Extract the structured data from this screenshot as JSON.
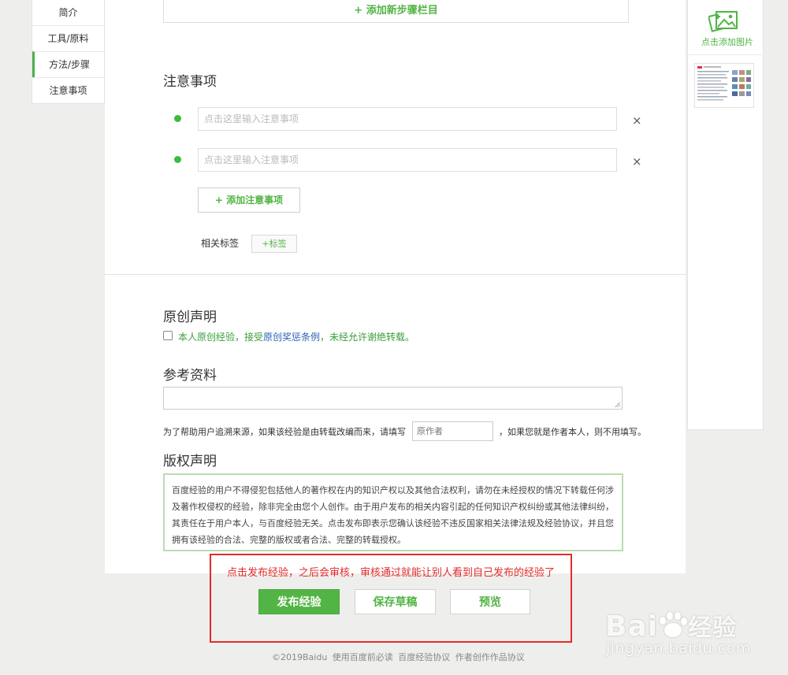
{
  "nav": {
    "items": [
      {
        "label": "简介"
      },
      {
        "label": "工具/原料"
      },
      {
        "label": "方法/步骤"
      },
      {
        "label": "注意事项"
      }
    ]
  },
  "steps": {
    "add_step_label": "+ 添加新步骤栏目"
  },
  "notes": {
    "title": "注意事项",
    "placeholder": "点击这里输入注意事项",
    "add_label": "+ 添加注意事项",
    "close_glyph": "×"
  },
  "tags": {
    "label": "相关标签",
    "button": "+标签"
  },
  "original": {
    "title": "原创声明",
    "text_before": "本人原创经验，接受",
    "link": "原创奖惩条例",
    "text_after": "，未经允许谢绝转载。"
  },
  "reference": {
    "title": "参考资料",
    "hint_before": "为了帮助用户追溯来源，如果该经验是由转载改编而来，请填写",
    "author_placeholder": "原作者",
    "hint_after": "，如果您就是作者本人，则不用填写。"
  },
  "copyright": {
    "title": "版权声明",
    "text": "百度经验的用户不得侵犯包括他人的著作权在内的知识产权以及其他合法权利，请勿在未经授权的情况下转载任何涉及著作权侵权的经验，除非完全由您个人创作。由于用户发布的相关内容引起的任何知识产权纠纷或其他法律纠纷，其责任在于用户本人，与百度经验无关。点击发布即表示您确认该经验不违反国家相关法律法规及经验协议，并且您拥有该经验的合法、完整的版权或者合法、完整的转载授权。"
  },
  "annotation": {
    "text": "点击发布经验，之后会审核，审核通过就能让别人看到自己发布的经验了"
  },
  "actions": {
    "publish": "发布经验",
    "draft": "保存草稿",
    "preview": "预览"
  },
  "footer": {
    "copyright": "©2019Baidu",
    "links": [
      "使用百度前必读",
      "百度经验协议",
      "作者创作作品协议"
    ]
  },
  "sidebar_right": {
    "add_image_label": "点击添加图片",
    "icon": "add-image-icon"
  },
  "watermark": {
    "logo_text": "Bai",
    "logo_cn": "经验",
    "url": "jingyan.baidu.com"
  },
  "colors": {
    "accent": "#52b445",
    "link": "#2f63b8",
    "annotation_red": "#e42a2a"
  }
}
